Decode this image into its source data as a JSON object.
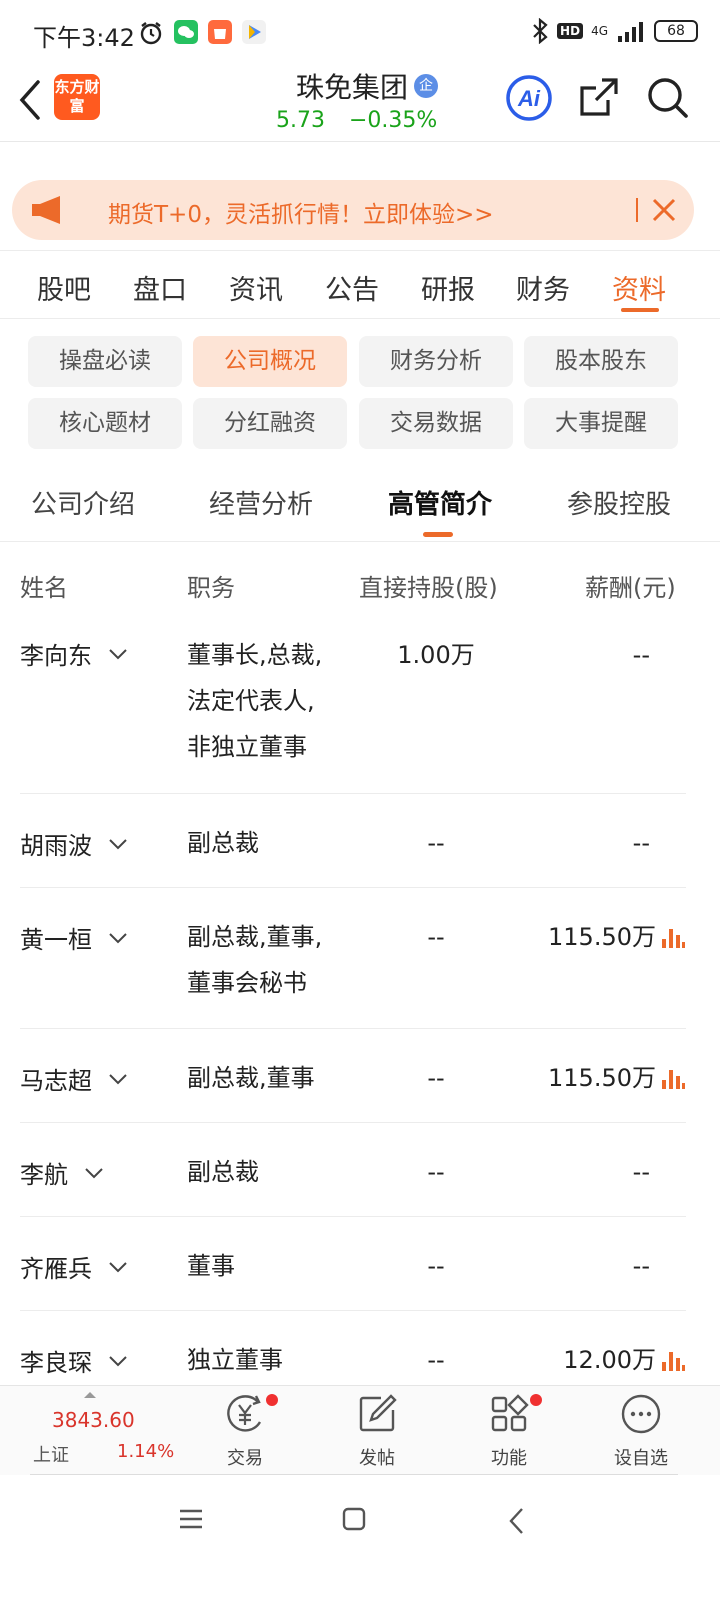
{
  "status_bar": {
    "time": "下午3:42",
    "hd": "HD",
    "network": "4G",
    "battery": "68"
  },
  "header": {
    "logo_text": "东方财富",
    "stock_name": "珠免集团",
    "badge": "企",
    "price": "5.73",
    "change": "−0.35%",
    "ai_label": "Ai",
    "colors": {
      "up": "#d9342b",
      "down": "#1aa31a",
      "accent": "#ec6a2a"
    }
  },
  "banner": {
    "text": "期货T+0，灵活抓行情！立即体验>>"
  },
  "main_tabs": [
    {
      "label": "股吧"
    },
    {
      "label": "盘口"
    },
    {
      "label": "资讯"
    },
    {
      "label": "公告"
    },
    {
      "label": "研报"
    },
    {
      "label": "财务"
    },
    {
      "label": "资料",
      "active": true
    }
  ],
  "chips": [
    {
      "label": "操盘必读"
    },
    {
      "label": "公司概况",
      "active": true
    },
    {
      "label": "财务分析"
    },
    {
      "label": "股本股东"
    },
    {
      "label": "核心题材"
    },
    {
      "label": "分红融资"
    },
    {
      "label": "交易数据"
    },
    {
      "label": "大事提醒"
    }
  ],
  "sub_tabs": [
    {
      "label": "公司介绍"
    },
    {
      "label": "经营分析"
    },
    {
      "label": "高管简介",
      "active": true
    },
    {
      "label": "参股控股"
    }
  ],
  "table": {
    "headers": {
      "name": "姓名",
      "position": "职务",
      "shares": "直接持股(股)",
      "salary": "薪酬(元)"
    },
    "rows": [
      {
        "name": "李向东",
        "position": [
          "董事长,总裁,",
          "法定代表人,",
          "非独立董事"
        ],
        "shares": "1.00万",
        "salary": "--",
        "chart": false
      },
      {
        "name": "胡雨波",
        "position": [
          "副总裁"
        ],
        "shares": "--",
        "salary": "--",
        "chart": false
      },
      {
        "name": "黄一桓",
        "position": [
          "副总裁,董事,",
          "董事会秘书"
        ],
        "shares": "--",
        "salary": "115.50万",
        "chart": true
      },
      {
        "name": "马志超",
        "position": [
          "副总裁,董事"
        ],
        "shares": "--",
        "salary": "115.50万",
        "chart": true
      },
      {
        "name": "李航",
        "position": [
          "副总裁"
        ],
        "shares": "--",
        "salary": "--",
        "chart": false
      },
      {
        "name": "齐雁兵",
        "position": [
          "董事"
        ],
        "shares": "--",
        "salary": "--",
        "chart": false
      },
      {
        "name": "李良琛",
        "position": [
          "独立董事"
        ],
        "shares": "--",
        "salary": "12.00万",
        "chart": true
      }
    ]
  },
  "bottom_bar": {
    "index_value": "3843.60",
    "index_name": "上证",
    "index_change": "1.14%",
    "items": [
      {
        "label": "交易",
        "icon": "trade-yen-icon",
        "dot": true
      },
      {
        "label": "发帖",
        "icon": "compose-icon",
        "dot": false
      },
      {
        "label": "功能",
        "icon": "apps-grid-icon",
        "dot": true
      },
      {
        "label": "设自选",
        "icon": "more-circle-icon",
        "dot": false
      }
    ]
  }
}
